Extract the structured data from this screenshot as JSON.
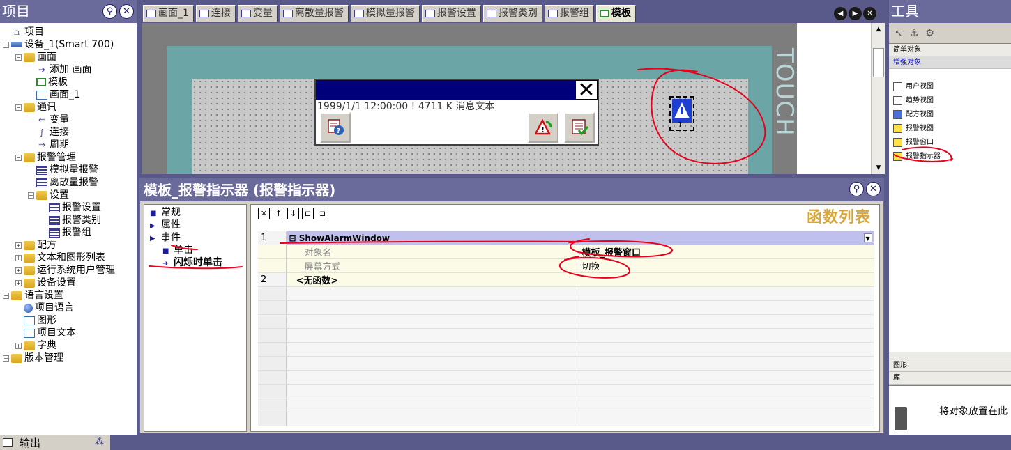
{
  "project_tree": {
    "title": "项目",
    "items": [
      {
        "label": "项目",
        "level": 0,
        "icon": "project-icon"
      },
      {
        "label": "设备_1(Smart 700)",
        "level": 0,
        "icon": "device-icon",
        "expand": "−"
      },
      {
        "label": "画面",
        "level": 1,
        "icon": "folder-icon",
        "expand": "−"
      },
      {
        "label": "添加 画面",
        "level": 2,
        "icon": "add-screen-icon"
      },
      {
        "label": "模板",
        "level": 2,
        "icon": "template-icon"
      },
      {
        "label": "画面_1",
        "level": 2,
        "icon": "screen-icon"
      },
      {
        "label": "通讯",
        "level": 1,
        "icon": "folder-icon",
        "expand": "−"
      },
      {
        "label": "变量",
        "level": 2,
        "icon": "tag-icon"
      },
      {
        "label": "连接",
        "level": 2,
        "icon": "connection-icon"
      },
      {
        "label": "周期",
        "level": 2,
        "icon": "cycle-icon"
      },
      {
        "label": "报警管理",
        "level": 1,
        "icon": "folder-icon",
        "expand": "−"
      },
      {
        "label": "模拟量报警",
        "level": 2,
        "icon": "analog-alarm-icon"
      },
      {
        "label": "离散量报警",
        "level": 2,
        "icon": "discrete-alarm-icon"
      },
      {
        "label": "设置",
        "level": 2,
        "icon": "folder-icon",
        "expand": "−"
      },
      {
        "label": "报警设置",
        "level": 3,
        "icon": "alarm-settings-icon"
      },
      {
        "label": "报警类别",
        "level": 3,
        "icon": "alarm-class-icon"
      },
      {
        "label": "报警组",
        "level": 3,
        "icon": "alarm-group-icon"
      },
      {
        "label": "配方",
        "level": 1,
        "icon": "folder-icon",
        "expand": "+"
      },
      {
        "label": "文本和图形列表",
        "level": 1,
        "icon": "folder-icon",
        "expand": "+"
      },
      {
        "label": "运行系统用户管理",
        "level": 1,
        "icon": "folder-icon",
        "expand": "+"
      },
      {
        "label": "设备设置",
        "level": 1,
        "icon": "folder-icon",
        "expand": "+"
      },
      {
        "label": "语言设置",
        "level": 0,
        "icon": "folder-icon",
        "expand": "−"
      },
      {
        "label": "项目语言",
        "level": 1,
        "icon": "globe-icon"
      },
      {
        "label": "图形",
        "level": 1,
        "icon": "graphics-icon"
      },
      {
        "label": "项目文本",
        "level": 1,
        "icon": "text-icon"
      },
      {
        "label": "字典",
        "level": 1,
        "icon": "folder-icon",
        "expand": "+"
      },
      {
        "label": "版本管理",
        "level": 0,
        "icon": "folder-icon",
        "expand": "+"
      }
    ]
  },
  "output": {
    "label": "输出"
  },
  "tabs": [
    {
      "label": "画面_1",
      "active": false
    },
    {
      "label": "连接",
      "active": false
    },
    {
      "label": "变量",
      "active": false
    },
    {
      "label": "离散量报警",
      "active": false
    },
    {
      "label": "模拟量报警",
      "active": false
    },
    {
      "label": "报警设置",
      "active": false
    },
    {
      "label": "报警类别",
      "active": false
    },
    {
      "label": "报警组",
      "active": false
    },
    {
      "label": "模板",
      "active": true
    }
  ],
  "canvas": {
    "touch_label": "TOUCH",
    "alarm_message": "1999/1/1 12:00:00 ! 4711 K 消息文本",
    "indicator_count": "1"
  },
  "properties": {
    "title": "模板_报警指示器 (报警指示器)",
    "categories": [
      {
        "label": "常规",
        "bullet": "■",
        "sub": false
      },
      {
        "label": "属性",
        "bullet": "▶",
        "sub": false
      },
      {
        "label": "事件",
        "bullet": "▶",
        "sub": false
      },
      {
        "label": "单击",
        "bullet": "■",
        "sub": true
      },
      {
        "label": "闪烁时单击",
        "bullet": "➜",
        "sub": true
      }
    ],
    "function_list_title": "函数列表",
    "functions": [
      {
        "num": "1",
        "name": "ShowAlarmWindow"
      },
      {
        "num": "2",
        "name": "<无函数>"
      }
    ],
    "params": [
      {
        "name": "对象名",
        "value": "模板_报警窗口"
      },
      {
        "name": "屏幕方式",
        "value": "切换"
      }
    ]
  },
  "tools": {
    "title": "工具",
    "sections": [
      {
        "label": "简单对象",
        "selected": false
      },
      {
        "label": "增强对象",
        "selected": true
      }
    ],
    "items": [
      {
        "label": "用户视图",
        "icon": "user-view-icon"
      },
      {
        "label": "趋势视图",
        "icon": "trend-view-icon"
      },
      {
        "label": "配方视图",
        "icon": "recipe-view-icon"
      },
      {
        "label": "报警视图",
        "icon": "alarm-view-icon"
      },
      {
        "label": "报警窗口",
        "icon": "alarm-window-icon"
      },
      {
        "label": "报警指示器",
        "icon": "alarm-indicator-icon"
      }
    ],
    "lower_sections": [
      {
        "label": "图形"
      },
      {
        "label": "库"
      }
    ],
    "drop_text": "将对象放置在此"
  },
  "colors": {
    "frame": "#5a5a8a",
    "title_bar": "#6b6b9b",
    "device_frame": "#6ba5a5",
    "function_header": "#d8a53a",
    "annotation": "#e8001c"
  }
}
